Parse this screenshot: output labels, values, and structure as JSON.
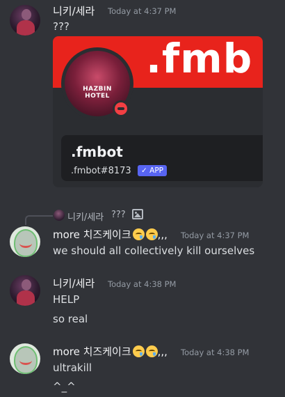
{
  "messages": [
    {
      "author": "니키/세라",
      "time": "Today at 4:37 PM",
      "lines": [
        "???"
      ],
      "embed": {
        "banner_text": ".fmb",
        "avatar_logo": "HAZBIN HOTEL",
        "bot_name": ".fmbot",
        "bot_tag": ".fmbot#8173",
        "badge": "✓ APP"
      }
    },
    {
      "reply": {
        "author": "니키/세라",
        "text": "???"
      },
      "author": "more 치즈케이크",
      "author_suffix": ",,,",
      "time": "Today at 4:37 PM",
      "lines": [
        "we should all collectively kill ourselves"
      ]
    },
    {
      "author": "니키/세라",
      "time": "Today at 4:38 PM",
      "lines": [
        "HELP",
        "so real"
      ]
    },
    {
      "author": "more 치즈케이크",
      "author_suffix": ",,,",
      "time": "Today at 4:38 PM",
      "lines": [
        "ultrakill",
        "^_^"
      ]
    }
  ],
  "colors": {
    "background": "#313338",
    "embed_background": "#2b2d31",
    "banner_red": "#e8231c",
    "app_badge": "#5865f2",
    "dnd_status": "#f23f43"
  }
}
